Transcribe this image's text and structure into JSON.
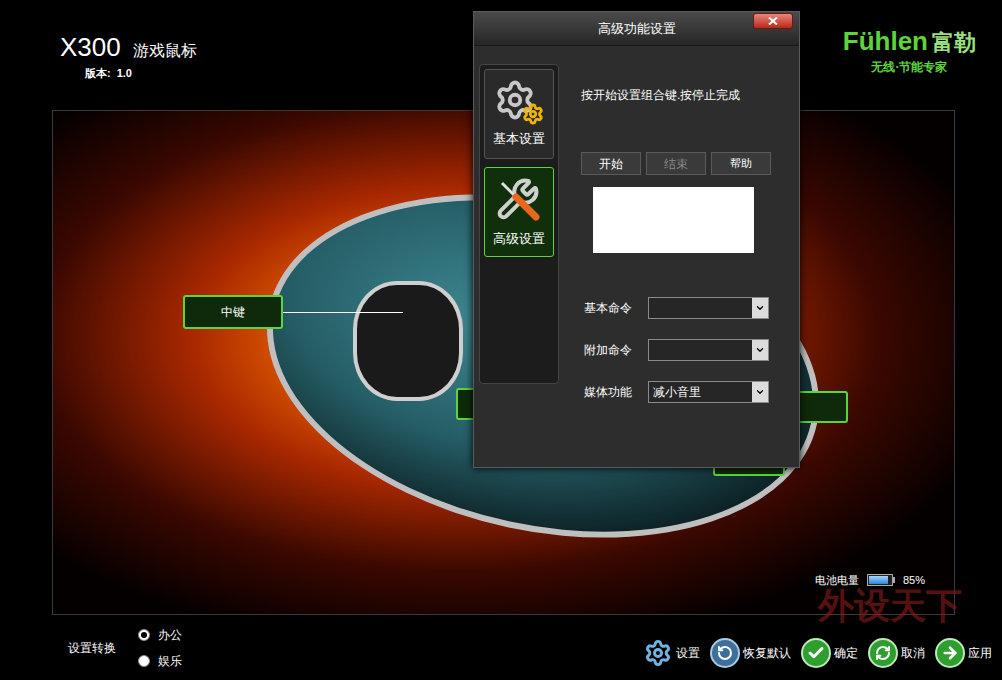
{
  "header": {
    "model": "X300",
    "subtitle": "游戏鼠标",
    "version_label": "版本:",
    "version": "1.0"
  },
  "logo": {
    "brand": "Fühlen",
    "brand_cn": "富勒",
    "slogan": "无线·节能专家"
  },
  "callouts": [
    {
      "label": "中键"
    }
  ],
  "dialog": {
    "title": "高级功能设置",
    "tabs": [
      {
        "label": "基本设置",
        "selected": false
      },
      {
        "label": "高级设置",
        "selected": true
      }
    ],
    "instruction": "按开始设置组合键.按停止完成",
    "buttons": [
      {
        "label": "开始",
        "disabled": false
      },
      {
        "label": "结束",
        "disabled": true
      },
      {
        "label": "帮助",
        "disabled": false
      }
    ],
    "fields": [
      {
        "label": "基本命令",
        "value": ""
      },
      {
        "label": "附加命令",
        "value": ""
      },
      {
        "label": "媒体功能",
        "value": "减小音里"
      }
    ]
  },
  "battery": {
    "label": "电池电量",
    "level": 0.85,
    "reading": "85%"
  },
  "mode": {
    "label": "设置转换",
    "options": [
      {
        "label": "办公",
        "selected": true
      },
      {
        "label": "娱乐",
        "selected": false
      }
    ]
  },
  "actions": [
    {
      "label": "设置"
    },
    {
      "label": "恢复默认"
    },
    {
      "label": "确定"
    },
    {
      "label": "取消"
    },
    {
      "label": "应用"
    }
  ],
  "watermark": "外设天下"
}
